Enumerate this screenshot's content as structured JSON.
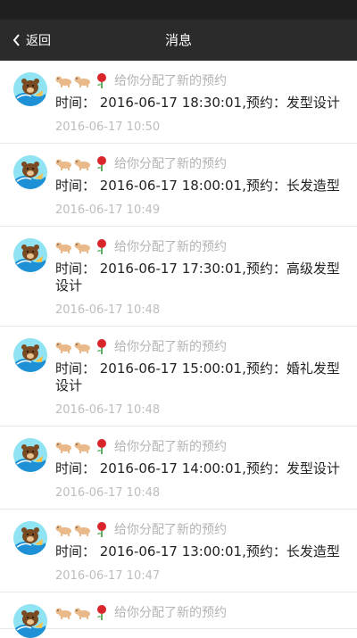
{
  "header": {
    "back_label": "返回",
    "title": "消息"
  },
  "messages": [
    {
      "sender_text": "给你分配了新的预约",
      "body": "时间： 2016-06-17 18:30:01,预约：发型设计",
      "time": "2016-06-17 10:50"
    },
    {
      "sender_text": "给你分配了新的预约",
      "body": "时间： 2016-06-17 18:00:01,预约：长发造型",
      "time": "2016-06-17 10:49"
    },
    {
      "sender_text": "给你分配了新的预约",
      "body": "时间： 2016-06-17 17:30:01,预约：高级发型设计",
      "time": "2016-06-17 10:48"
    },
    {
      "sender_text": "给你分配了新的预约",
      "body": "时间： 2016-06-17 15:00:01,预约：婚礼发型设计",
      "time": "2016-06-17 10:48"
    },
    {
      "sender_text": "给你分配了新的预约",
      "body": "时间： 2016-06-17 14:00:01,预约：发型设计",
      "time": "2016-06-17 10:48"
    },
    {
      "sender_text": "给你分配了新的预约",
      "body": "时间： 2016-06-17 13:00:01,预约：长发造型",
      "time": "2016-06-17 10:47"
    },
    {
      "sender_text": "给你分配了新的预约",
      "body": "",
      "time": ""
    }
  ],
  "icons": {
    "back": "chevron-left-icon",
    "avatar": "brown-bear-surfing-avatar",
    "emoji": [
      "dog-emoji",
      "dog-emoji",
      "rose-emoji"
    ]
  },
  "colors": {
    "navbar": "#2b2b2b",
    "statusbar": "#1f1f1f",
    "avatar_bg": "#8fe3f2",
    "sender_text": "#b3b3b3",
    "timestamp": "#bdbdbd",
    "body_text": "#222222"
  }
}
